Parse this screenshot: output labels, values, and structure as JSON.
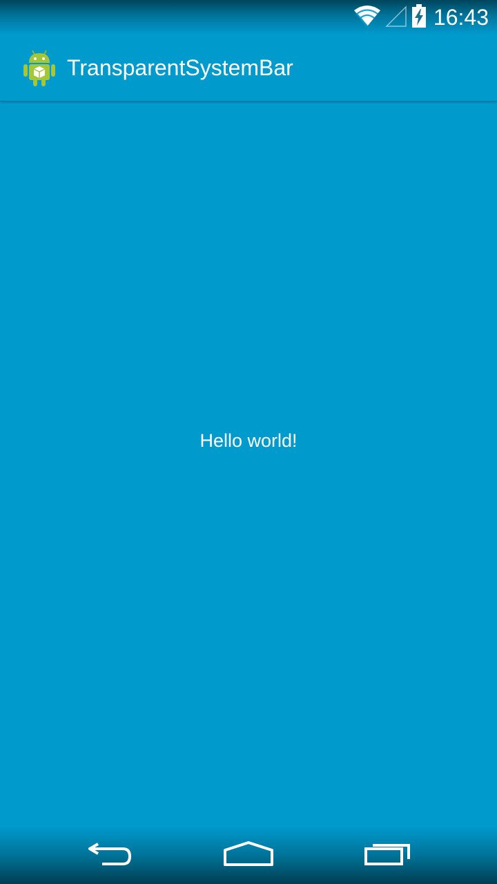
{
  "status_bar": {
    "time": "16:43",
    "icons": [
      "wifi-icon",
      "cell-signal-icon",
      "battery-charging-icon"
    ]
  },
  "action_bar": {
    "app_icon": "android-app-icon",
    "title": "TransparentSystemBar"
  },
  "content": {
    "message": "Hello world!"
  },
  "nav_bar": {
    "buttons": [
      "back-icon",
      "home-icon",
      "recents-icon"
    ]
  },
  "colors": {
    "background": "#009ACD",
    "text": "#FFFFFF",
    "android_green": "#A4C639"
  }
}
